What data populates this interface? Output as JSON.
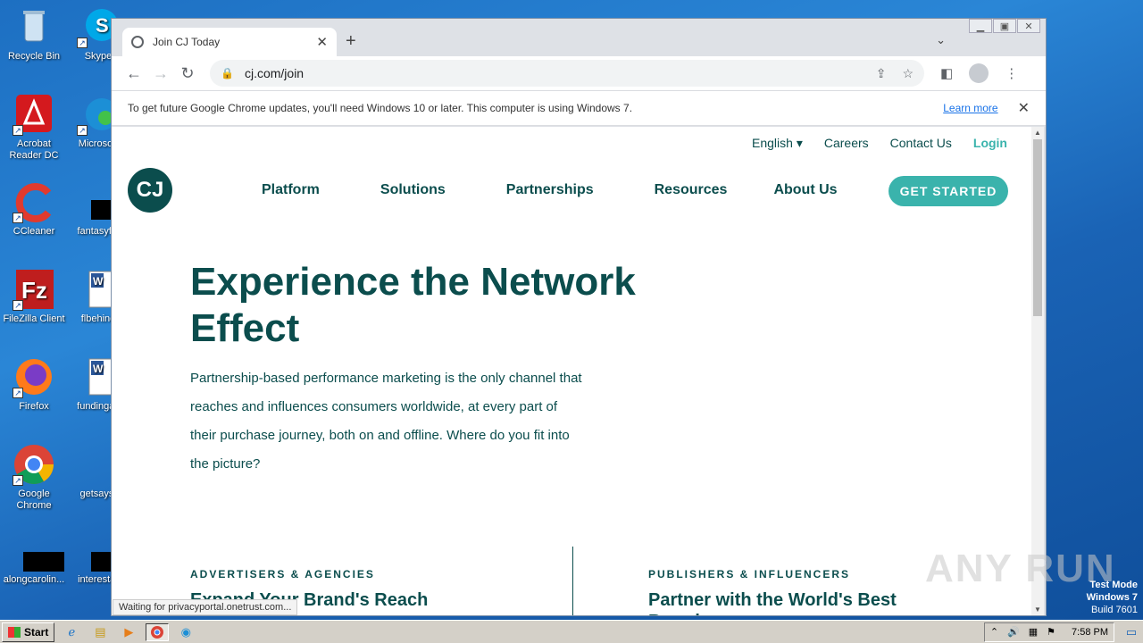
{
  "desktop": {
    "icons": [
      {
        "label": "Recycle Bin"
      },
      {
        "label": "Skype"
      },
      {
        "label": "Acrobat Reader DC"
      },
      {
        "label": "Microsoft"
      },
      {
        "label": "CCleaner"
      },
      {
        "label": "fantasyfie"
      },
      {
        "label": "FileZilla Client"
      },
      {
        "label": "flbehind"
      },
      {
        "label": "Firefox"
      },
      {
        "label": "fundingas"
      },
      {
        "label": "Google Chrome"
      },
      {
        "label": "getsays."
      },
      {
        "label": "alongcarolin..."
      },
      {
        "label": "interestar"
      }
    ]
  },
  "browser": {
    "tab_title": "Join CJ Today",
    "url": "cj.com/join",
    "infobar_message": "To get future Google Chrome updates, you'll need Windows 10 or later. This computer is using Windows 7.",
    "infobar_link": "Learn more",
    "status_text": "Waiting for privacyportal.onetrust.com..."
  },
  "site": {
    "logo_text": "CJ",
    "util_nav": {
      "language": "English",
      "careers": "Careers",
      "contact": "Contact Us",
      "login": "Login"
    },
    "main_nav": [
      "Platform",
      "Solutions",
      "Partnerships",
      "Resources",
      "About Us"
    ],
    "cta": "GET STARTED",
    "hero_title": "Experience the Network Effect",
    "hero_body": "Partnership-based performance marketing is the only channel that reaches and influences consumers worldwide, at every part of their purchase journey, both on and offline. Where do you fit into the picture?",
    "col_left_label": "ADVERTISERS & AGENCIES",
    "col_left_heading": "Expand Your Brand's Reach",
    "col_right_label": "PUBLISHERS & INFLUENCERS",
    "col_right_heading": "Partner with the World's Best Brands"
  },
  "watermark": "ANY RUN",
  "os": {
    "test_mode": "Test Mode",
    "os_name": "Windows 7",
    "build": "Build 7601",
    "clock": "7:58 PM",
    "start_label": "Start"
  }
}
